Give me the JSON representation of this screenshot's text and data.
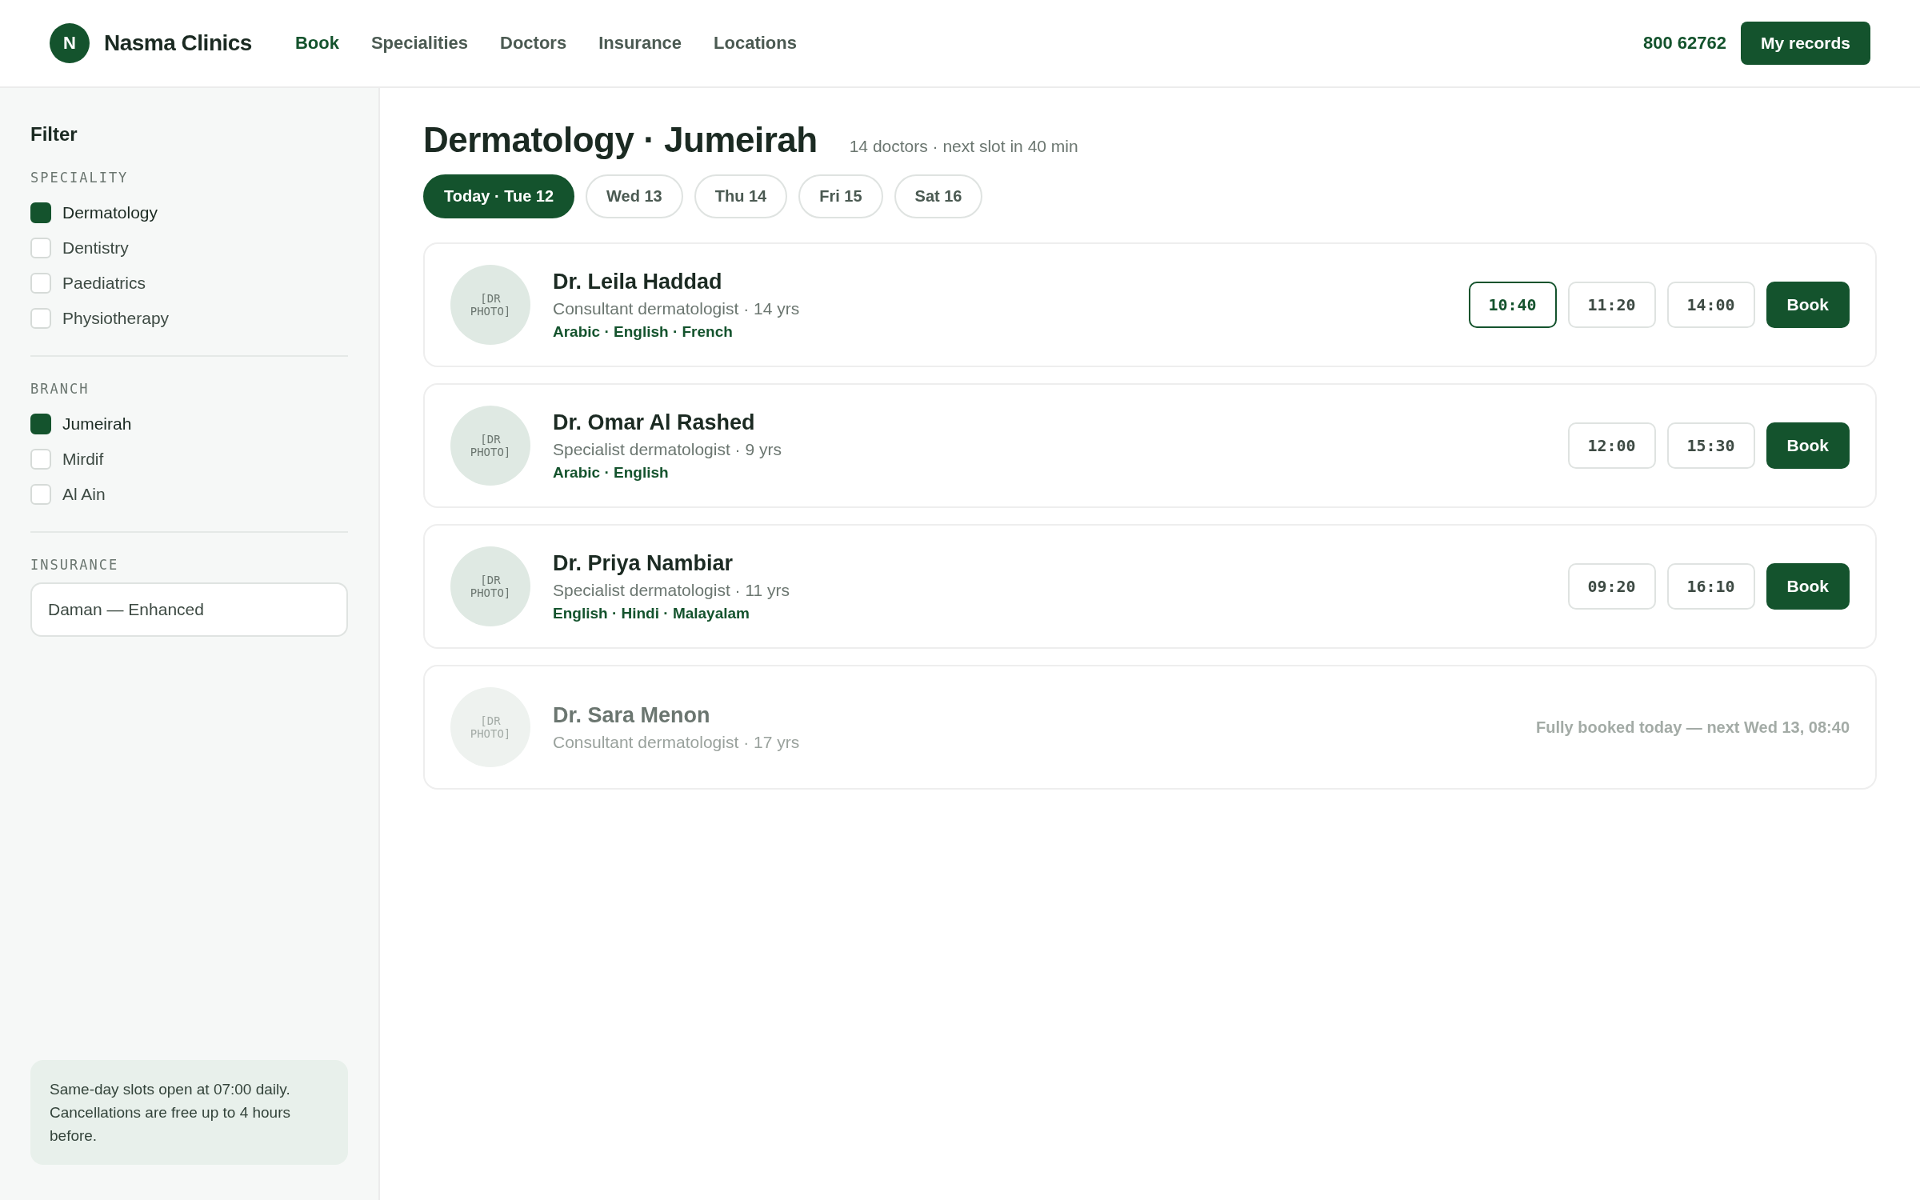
{
  "header": {
    "logo_letter": "N",
    "brand": "Nasma Clinics",
    "nav": [
      {
        "label": "Book",
        "selected": true
      },
      {
        "label": "Specialities",
        "selected": false
      },
      {
        "label": "Doctors",
        "selected": false
      },
      {
        "label": "Insurance",
        "selected": false
      },
      {
        "label": "Locations",
        "selected": false
      }
    ],
    "phone": "800 62762",
    "records_button": "My records"
  },
  "sidebar": {
    "title": "Filter",
    "groups": [
      {
        "heading": "SPECIALITY",
        "options": [
          {
            "label": "Dermatology",
            "checked": true
          },
          {
            "label": "Dentistry",
            "checked": false
          },
          {
            "label": "Paediatrics",
            "checked": false
          },
          {
            "label": "Physiotherapy",
            "checked": false
          }
        ]
      },
      {
        "heading": "BRANCH",
        "options": [
          {
            "label": "Jumeirah",
            "checked": true
          },
          {
            "label": "Mirdif",
            "checked": false
          },
          {
            "label": "Al Ain",
            "checked": false
          }
        ]
      }
    ],
    "insurance": {
      "heading": "INSURANCE",
      "value": "Daman — Enhanced"
    },
    "note": "Same-day slots open at 07:00 daily. Cancellations are free up to 4 hours before."
  },
  "main": {
    "title": "Dermatology · Jumeirah",
    "summary": "14 doctors · next slot in 40 min",
    "days": [
      {
        "label": "Today · Tue 12",
        "selected": true
      },
      {
        "label": "Wed 13",
        "selected": false
      },
      {
        "label": "Thu 14",
        "selected": false
      },
      {
        "label": "Fri 15",
        "selected": false
      },
      {
        "label": "Sat 16",
        "selected": false
      }
    ],
    "doctors": [
      {
        "photo_label": "[DR PHOTO]",
        "name": "Dr. Leila Haddad",
        "role": "Consultant dermatologist · 14 yrs",
        "languages": "Arabic · English · French",
        "available": true,
        "slots": [
          {
            "time": "10:40",
            "selected": true
          },
          {
            "time": "11:20",
            "selected": false
          },
          {
            "time": "14:00",
            "selected": false
          }
        ],
        "book": "Book"
      },
      {
        "photo_label": "[DR PHOTO]",
        "name": "Dr. Omar Al Rashed",
        "role": "Specialist dermatologist · 9 yrs",
        "languages": "Arabic · English",
        "available": true,
        "slots": [
          {
            "time": "12:00",
            "selected": false
          },
          {
            "time": "15:30",
            "selected": false
          }
        ],
        "book": "Book"
      },
      {
        "photo_label": "[DR PHOTO]",
        "name": "Dr. Priya Nambiar",
        "role": "Specialist dermatologist · 11 yrs",
        "languages": "English · Hindi · Malayalam",
        "available": true,
        "slots": [
          {
            "time": "09:20",
            "selected": false
          },
          {
            "time": "16:10",
            "selected": false
          }
        ],
        "book": "Book"
      },
      {
        "photo_label": "[DR PHOTO]",
        "name": "Dr. Sara Menon",
        "role": "Consultant dermatologist · 17 yrs",
        "available": false,
        "status": "Fully booked today — next Wed 13, 08:40"
      }
    ]
  }
}
